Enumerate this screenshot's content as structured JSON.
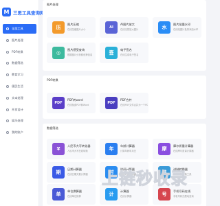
{
  "app": {
    "logo_glyph": "M",
    "title": "三思工具查询网"
  },
  "sidebar": {
    "items": [
      {
        "label": "全部工具",
        "active": true
      },
      {
        "label": "图片处理"
      },
      {
        "label": "PDF转换"
      },
      {
        "label": "数据筛选"
      },
      {
        "label": "教育学习"
      },
      {
        "label": "便民生活"
      },
      {
        "label": "文本处理"
      },
      {
        "label": "开发设计"
      },
      {
        "label": "娱乐处理"
      },
      {
        "label": "我的账户"
      }
    ]
  },
  "sections": [
    {
      "title": "图片处理",
      "cards": [
        {
          "name": "图片压缩",
          "desc": "在线压缩图片大小",
          "glyph": "压",
          "color": "#f39a2b"
        },
        {
          "name": "AI图片放大",
          "desc": "在线无损放大图片",
          "glyph": "AI",
          "color": "#5a64d6"
        },
        {
          "name": "图片批量水印",
          "desc": "在线给图片批量添加水印",
          "glyph": "水",
          "color": "#2a8df6"
        },
        {
          "name": "图片感受查询",
          "desc": "根据图片分析颜色等信息",
          "glyph": "◎",
          "color": "#3dba9e"
        },
        {
          "name": "电子签名",
          "desc": "在线生成电子签名",
          "glyph": "签",
          "color": "#2ab0d8"
        }
      ]
    },
    {
      "title": "PDF转换",
      "cards": [
        {
          "name": "PDF转word",
          "desc": "在线免费PDF转Word",
          "glyph": "PDF",
          "color": "#5a3ec8"
        },
        {
          "name": "PDF合并",
          "desc": "在线PDF文件合并为一个PDF",
          "glyph": "PDF",
          "color": "#4a3ec0"
        }
      ]
    },
    {
      "title": "数据筛选",
      "cards": [
        {
          "name": "人民币大写转化器",
          "desc": "人民币大写在线转换",
          "glyph": "¥",
          "color": "#8a52d6"
        },
        {
          "name": "年龄计算器",
          "desc": "计算年龄年月日",
          "glyph": "年",
          "color": "#2a7ef0"
        },
        {
          "name": "摩尔质量计算器",
          "desc": "在线摩尔质量计算器",
          "glyph": "摩",
          "color": "#8a4ee0"
        },
        {
          "name": "日期计算器",
          "desc": "在线日期天数计算器",
          "glyph": "期",
          "color": "#3a5ae6"
        },
        {
          "name": "时间计算器",
          "desc": "在线时间计算器",
          "glyph": "时",
          "color": "#2a8cf0"
        },
        {
          "name": "进制转换器",
          "desc": "在线进制转换工具",
          "glyph": "进",
          "color": "#3a9bd8"
        },
        {
          "name": "单位换算器",
          "desc": "在线单位换算",
          "glyph": "单",
          "color": "#4a5ad6"
        },
        {
          "name": "计算器",
          "desc": "在线计算器",
          "glyph": "计",
          "color": "#2a9cf0"
        },
        {
          "name": "手机号码在线",
          "desc": "手机号码归属地查询",
          "glyph": "号",
          "color": "#d6454e"
        }
      ]
    }
  ],
  "watermark": "上链秒收录"
}
